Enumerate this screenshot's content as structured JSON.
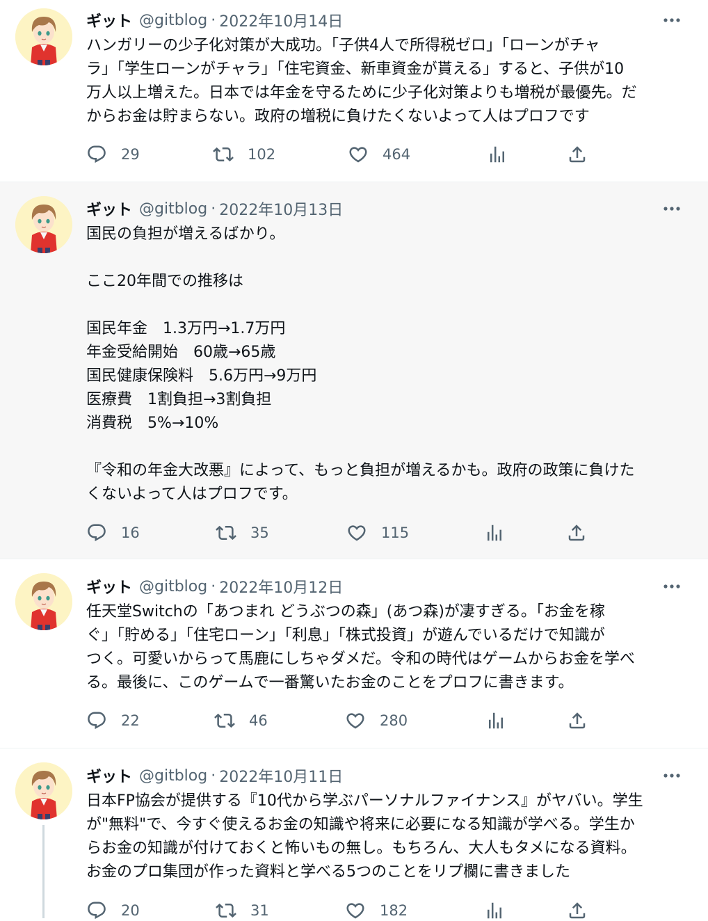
{
  "tweets": [
    {
      "name": "ギット",
      "handle": "@gitblog",
      "sep": "·",
      "date": "2022年10月14日",
      "text": "ハンガリーの少子化対策が大成功。「子供4人で所得税ゼロ」「ローンがチャ\nラ」「学生ローンがチャラ」「住宅資金、新車資金が貰える」すると、子供が10\n万人以上増えた。日本では年金を守るために少子化対策よりも増税が最優先。だ\nからお金は貯まらない。政府の増税に負けたくないよって人はプロフです",
      "replies": "29",
      "retweets": "102",
      "likes": "464"
    },
    {
      "name": "ギット",
      "handle": "@gitblog",
      "sep": "·",
      "date": "2022年10月13日",
      "text": "国民の負担が増えるばかり。\n\nここ20年間での推移は\n\n国民年金　1.3万円→1.7万円\n年金受給開始　60歳→65歳\n国民健康保険料　5.6万円→9万円\n医療費　1割負担→3割負担\n消費税　5%→10%\n\n『令和の年金大改悪』によって、もっと負担が増えるかも。政府の政策に負けた\nくないよって人はプロフです。",
      "replies": "16",
      "retweets": "35",
      "likes": "115"
    },
    {
      "name": "ギット",
      "handle": "@gitblog",
      "sep": "·",
      "date": "2022年10月12日",
      "text": "任天堂Switchの「あつまれ どうぶつの森」(あつ森)が凄すぎる。「お金を稼\nぐ」「貯める」「住宅ローン」「利息」「株式投資」が遊んでいるだけで知識が\nつく。可愛いからって馬鹿にしちゃダメだ。令和の時代はゲームからお金を学べ\nる。最後に、このゲームで一番驚いたお金のことをプロフに書きます。",
      "replies": "22",
      "retweets": "46",
      "likes": "280"
    },
    {
      "name": "ギット",
      "handle": "@gitblog",
      "sep": "·",
      "date": "2022年10月11日",
      "text": "日本FP協会が提供する『10代から学ぶパーソナルファイナンス』がヤバい。学生\nが\"無料\"で、今すぐ使えるお金の知識や将来に必要になる知識が学べる。学生か\nらお金の知識が付けておくと怖いもの無し。もちろん、大人もタメになる資料。\nお金のプロ集団が作った資料と学べる5つのことをリプ欄に書きました",
      "replies": "20",
      "retweets": "31",
      "likes": "182"
    }
  ],
  "icons": [
    "reply-icon",
    "retweet-icon",
    "like-icon",
    "analytics-icon",
    "share-icon",
    "more-icon"
  ],
  "colors": {
    "text": "#0f1419",
    "secondary": "#536471",
    "highlight_bg": "#f7f7f7",
    "avatar_bg": "#fdf4c4"
  }
}
